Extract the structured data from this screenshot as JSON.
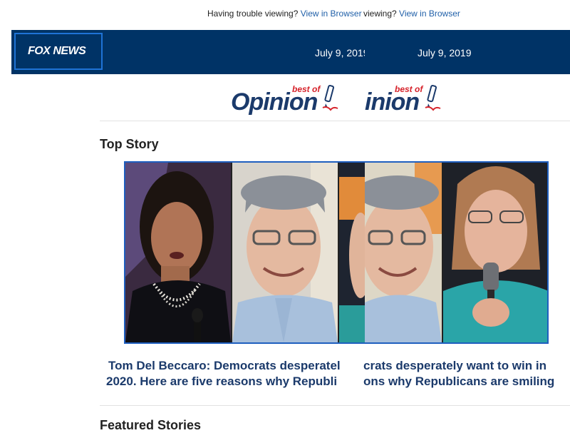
{
  "preheader": {
    "trouble_text": "Having trouble viewing?",
    "view_link": "View in Browser",
    "dup_prefix_text": "viewing?"
  },
  "header": {
    "logo_text": "FOX NEWS",
    "date": "July 9, 2019",
    "date_partial": "July 9, 2019"
  },
  "banner": {
    "best_of": "best of",
    "opinion": "Opinion",
    "opinion_partial": "inion"
  },
  "top_story": {
    "section_title": "Top Story",
    "headline_line1_a": "Tom Del Beccaro: Democrats desperatel",
    "headline_line1_b": "crats desperately want to win in",
    "headline_line2_a": "2020. Here are five reasons why Republi",
    "headline_line2_b": "ons why Republicans are smiling"
  },
  "featured": {
    "section_title": "Featured Stories"
  },
  "colors": {
    "header_bg": "#003366",
    "link": "#1f5fa8",
    "headline": "#1b3a6b",
    "accent_red": "#d6222a",
    "image_border": "#1f5fbf"
  }
}
